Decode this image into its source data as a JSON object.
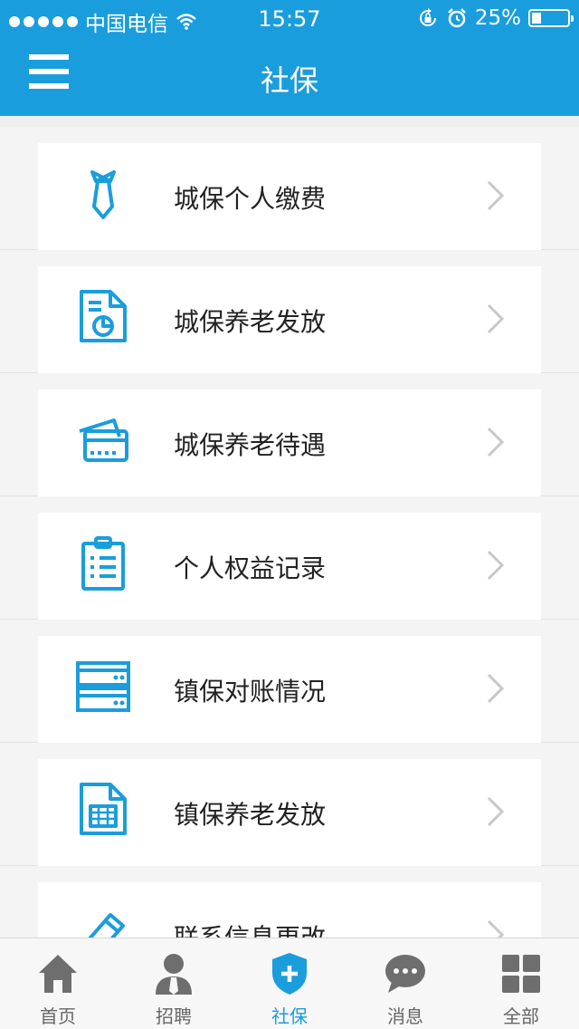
{
  "status_bar": {
    "carrier": "中国电信",
    "time": "15:57",
    "battery": "25%"
  },
  "header": {
    "title": "社保",
    "menu_icon": "hamburger-icon"
  },
  "menu_items": [
    {
      "label": "城保个人缴费",
      "icon": "tie-icon"
    },
    {
      "label": "城保养老发放",
      "icon": "document-chart-icon"
    },
    {
      "label": "城保养老待遇",
      "icon": "bank-card-icon"
    },
    {
      "label": "个人权益记录",
      "icon": "clipboard-list-icon"
    },
    {
      "label": "镇保对账情况",
      "icon": "server-icon"
    },
    {
      "label": "镇保养老发放",
      "icon": "spreadsheet-icon"
    },
    {
      "label": "联系信息更改",
      "icon": "pencil-icon"
    }
  ],
  "tabs": [
    {
      "label": "首页",
      "icon": "home-icon"
    },
    {
      "label": "招聘",
      "icon": "person-tie-icon"
    },
    {
      "label": "社保",
      "icon": "shield-plus-icon",
      "active": true
    },
    {
      "label": "消息",
      "icon": "chat-bubble-icon"
    },
    {
      "label": "全部",
      "icon": "grid-icon"
    }
  ],
  "colors": {
    "primary": "#1a9ddc",
    "background": "#eeeeee",
    "tab_inactive": "#666666"
  }
}
